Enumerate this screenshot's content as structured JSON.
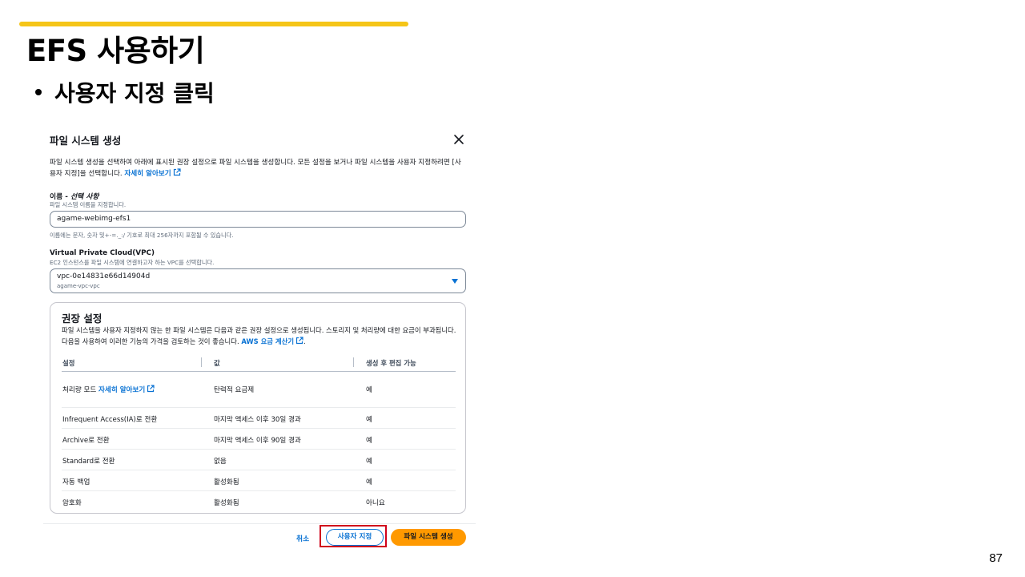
{
  "slide": {
    "title": "EFS 사용하기",
    "bullet": "사용자 지정 클릭",
    "page_number": "87",
    "accent_color": "#f5c518"
  },
  "dialog": {
    "title": "파일 시스템 생성",
    "close_icon": "close-icon",
    "description_text": "파일 시스템 생성을 선택하여 아래에 표시된 권장 설정으로 파일 시스템을 생성합니다. 모든 설정을 보거나 파일 시스템을 사용자 지정하려면 [사용자 지정]을 선택합니다.",
    "description_link": "자세히 알아보기",
    "name_field": {
      "label": "이름 - ",
      "label_optional": "선택 사항",
      "hint": "파일 시스템 이름을 지정합니다.",
      "value": "agame-webimg-efs1",
      "constraint": "이름에는 문자, 숫자 및+-=._:/ 기호로 최대 256자까지 포함될 수 있습니다."
    },
    "vpc_field": {
      "label": "Virtual Private Cloud(VPC)",
      "hint": "EC2 인스턴스를 파일 시스템에 연결하고자 하는 VPC를 선택합니다.",
      "selected_value": "vpc-0e14831e66d14904d",
      "selected_sub": "agame-vpc-vpc"
    },
    "recommended": {
      "title": "권장 설정",
      "description_text": "파일 시스템을 사용자 지정하지 않는 한 파일 시스템은 다음과 같은 권장 설정으로 생성됩니다. 스토리지 및 처리량에 대한 요금이 부과됩니다. 다음을 사용하여 이러한 기능의 가격을 검토하는 것이 좋습니다.",
      "description_link": "AWS 요금 계산기",
      "description_end": ".",
      "columns": [
        "설정",
        "값",
        "생성 후 편집 가능"
      ],
      "rows": [
        {
          "setting": "처리량 모드",
          "link": "자세히 알아보기",
          "value": "탄력적 요금제",
          "editable": "예"
        },
        {
          "setting": "Infrequent Access(IA)로 전환",
          "value": "마지막 액세스 이후 30일 경과",
          "editable": "예"
        },
        {
          "setting": "Archive로 전환",
          "value": "마지막 액세스 이후 90일 경과",
          "editable": "예"
        },
        {
          "setting": "Standard로 전환",
          "value": "없음",
          "editable": "예"
        },
        {
          "setting": "자동 백업",
          "value": "활성화됨",
          "editable": "예"
        },
        {
          "setting": "암호화",
          "value": "활성화됨",
          "editable": "아니요"
        }
      ]
    },
    "footer": {
      "cancel_label": "취소",
      "customize_label": "사용자 지정",
      "create_label": "파일 시스템 생성",
      "highlight_color": "#d0021b",
      "primary_color": "#ff9900"
    }
  }
}
